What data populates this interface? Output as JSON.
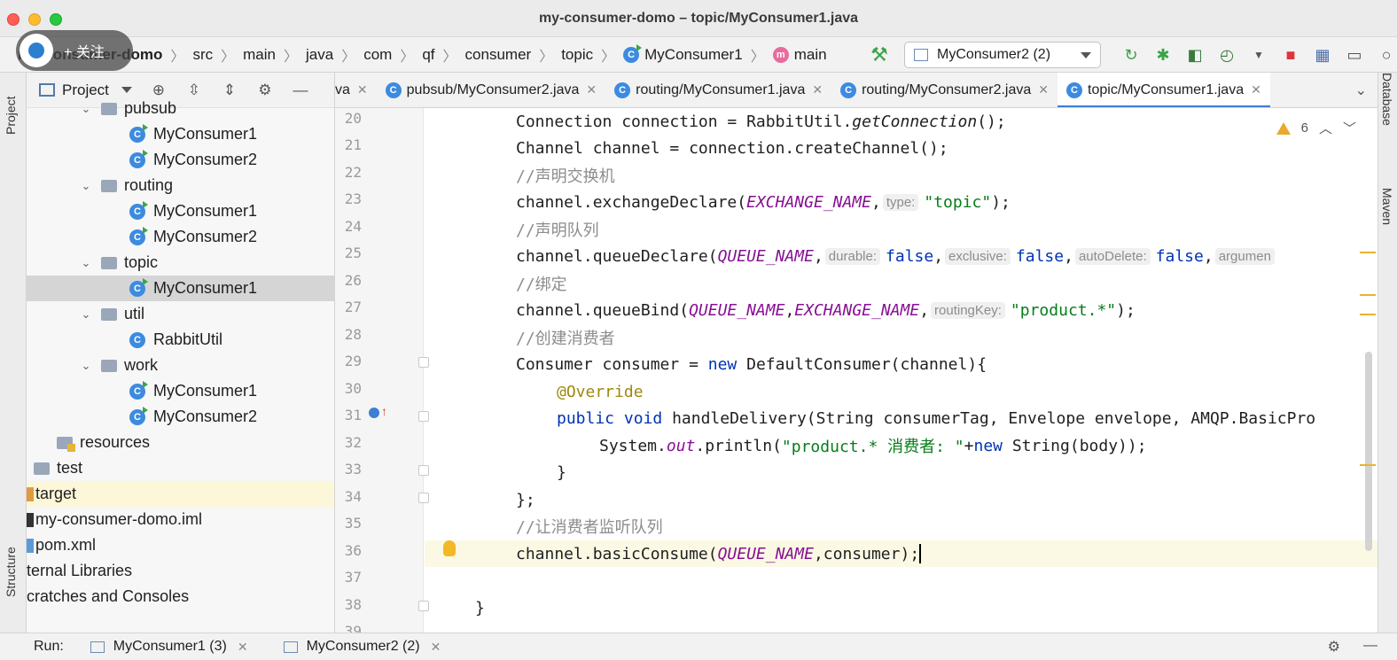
{
  "window": {
    "title": "my-consumer-domo – topic/MyConsumer1.java"
  },
  "overlay": {
    "follow_label": "+ 关注"
  },
  "navbar": {
    "crumbs": [
      "my-consumer-domo",
      "src",
      "main",
      "java",
      "com",
      "qf",
      "consumer",
      "topic"
    ],
    "class_crumb": "MyConsumer1",
    "method_crumb": "main",
    "run_config": "MyConsumer2 (2)"
  },
  "project_panel": {
    "title": "Project",
    "tree": [
      {
        "label": "pubsub",
        "type": "folder"
      },
      {
        "label": "MyConsumer1",
        "type": "class"
      },
      {
        "label": "MyConsumer2",
        "type": "class"
      },
      {
        "label": "routing",
        "type": "folder"
      },
      {
        "label": "MyConsumer1",
        "type": "class"
      },
      {
        "label": "MyConsumer2",
        "type": "class"
      },
      {
        "label": "topic",
        "type": "folder"
      },
      {
        "label": "MyConsumer1",
        "type": "class"
      },
      {
        "label": "util",
        "type": "folder"
      },
      {
        "label": "RabbitUtil",
        "type": "class"
      },
      {
        "label": "work",
        "type": "folder"
      },
      {
        "label": "MyConsumer1",
        "type": "class"
      },
      {
        "label": "MyConsumer2",
        "type": "class"
      },
      {
        "label": "resources",
        "type": "folder"
      },
      {
        "label": "test",
        "type": "folder"
      },
      {
        "label": "target",
        "type": "folder"
      },
      {
        "label": "my-consumer-domo.iml",
        "type": "file"
      },
      {
        "label": "pom.xml",
        "type": "file"
      },
      {
        "label": "ternal Libraries",
        "type": "item"
      },
      {
        "label": "cratches and Consoles",
        "type": "item"
      }
    ]
  },
  "tabs": [
    {
      "label": "va"
    },
    {
      "label": "pubsub/MyConsumer2.java"
    },
    {
      "label": "routing/MyConsumer1.java"
    },
    {
      "label": "routing/MyConsumer2.java"
    },
    {
      "label": "topic/MyConsumer1.java",
      "active": true
    }
  ],
  "editor": {
    "warning_count": "6",
    "line_numbers": [
      "20",
      "21",
      "22",
      "23",
      "24",
      "25",
      "26",
      "27",
      "28",
      "29",
      "30",
      "31",
      "32",
      "33",
      "34",
      "35",
      "36",
      "37",
      "38",
      "39"
    ],
    "code": {
      "l20a": "Connection connection = RabbitUtil.",
      "l20b": "getConnection",
      "l20c": "();",
      "l21": "Channel channel = connection.createChannel();",
      "l22": "//声明交换机",
      "l23a": "channel.exchangeDeclare(",
      "l23b": "EXCHANGE_NAME",
      "l23c": ",",
      "l23hint": "type:",
      "l23d": "\"topic\"",
      "l23e": ");",
      "l24": "//声明队列",
      "l25a": "channel.queueDeclare(",
      "l25b": "QUEUE_NAME",
      "l25c": ",",
      "l25h1": "durable:",
      "l25k1": "false",
      "l25c2": ",",
      "l25h2": "exclusive:",
      "l25k2": "false",
      "l25c3": ",",
      "l25h3": "autoDelete:",
      "l25k3": "false",
      "l25c4": ",",
      "l25h4": "argumen",
      "l26": "//绑定",
      "l27a": "channel.queueBind(",
      "l27b": "QUEUE_NAME",
      "l27c": ",",
      "l27d": "EXCHANGE_NAME",
      "l27e": ",",
      "l27hint": "routingKey:",
      "l27f": "\"product.*\"",
      "l27g": ");",
      "l28": "//创建消费者",
      "l29a": "Consumer consumer = ",
      "l29b": "new",
      "l29c": " DefaultConsumer(channel){",
      "l30": "@Override",
      "l31a": "public",
      "l31b": " ",
      "l31c": "void",
      "l31d": " handleDelivery(String consumerTag, Envelope envelope, AMQP.BasicPro",
      "l32a": "System.",
      "l32b": "out",
      "l32c": ".println(",
      "l32d": "\"product.* 消费者: \"",
      "l32e": "+",
      "l32f": "new",
      "l32g": " String(body));",
      "l33": "}",
      "l34": "};",
      "l35": "//让消费者监听队列",
      "l36a": "channel.basicConsume(",
      "l36b": "QUEUE_NAME",
      "l36c": ",consumer);",
      "l38": "}"
    }
  },
  "sidebar_left": {
    "project": "Project",
    "structure": "Structure"
  },
  "sidebar_right": {
    "database": "Database",
    "maven": "Maven"
  },
  "runbar": {
    "label": "Run:",
    "tabs": [
      "MyConsumer1 (3)",
      "MyConsumer2 (2)"
    ]
  },
  "colors": {
    "keyword": "#0033b3",
    "string": "#067d17",
    "constant": "#871094",
    "comment": "#8c8c8c",
    "annotation": "#9e880d",
    "active_tab_underline": "#3d7fd6"
  }
}
